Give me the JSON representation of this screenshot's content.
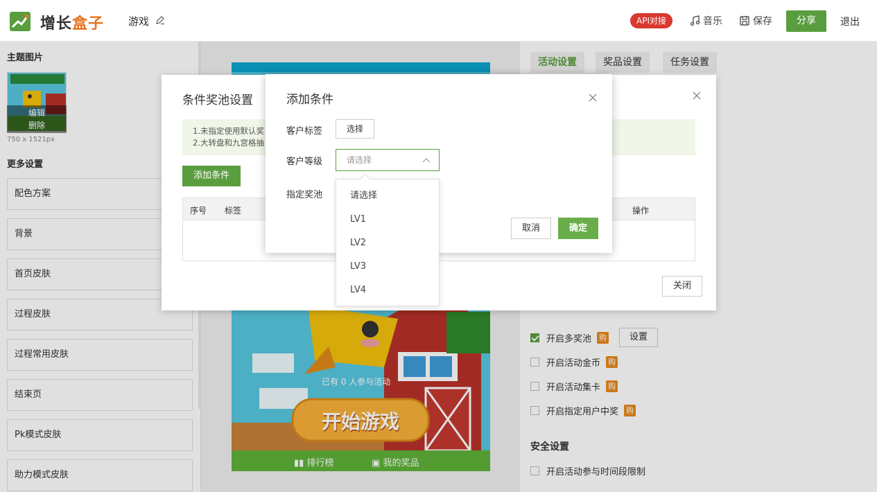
{
  "header": {
    "brand_part1": "增长",
    "brand_part2": "盒子",
    "game_name": "游戏",
    "api_badge": "API对接",
    "music": "音乐",
    "save": "保存",
    "share": "分享",
    "logout": "退出"
  },
  "left": {
    "theme_title": "主题图片",
    "thumb_edit": "编辑",
    "thumb_delete": "删除",
    "dimensions": "750 x 1521px",
    "more_title": "更多设置",
    "menu": [
      "配色方案",
      "背景",
      "首页皮肤",
      "过程皮肤",
      "过程常用皮肤",
      "结束页",
      "Pk模式皮肤",
      "助力模式皮肤"
    ]
  },
  "preview": {
    "participants": "已有 0 人参与活动",
    "start": "开始游戏",
    "ranking": "排行榜",
    "my_prizes": "我的奖品"
  },
  "right": {
    "tabs": [
      "活动设置",
      "奖品设置",
      "任务设置"
    ],
    "options": [
      {
        "label": "开启多奖池",
        "checked": true,
        "buy": "购",
        "button": "设置"
      },
      {
        "label": "开启活动金币",
        "checked": false,
        "buy": "购"
      },
      {
        "label": "开启活动集卡",
        "checked": false,
        "buy": "购"
      },
      {
        "label": "开启指定用户中奖",
        "checked": false,
        "buy": "购"
      }
    ],
    "security_title": "安全设置",
    "security_option": "开启活动参与时间段限制"
  },
  "pool_dialog": {
    "title": "条件奖池设置",
    "notice_line1": "1.未指定使用默认奖",
    "notice_line2": "2.大转盘和九宫格抽",
    "add_condition": "添加条件",
    "col_index": "序号",
    "col_tag": "标签",
    "col_action": "操作",
    "close": "关闭"
  },
  "add_dialog": {
    "title": "添加条件",
    "tag_label": "客户标签",
    "select_button": "选择",
    "level_label": "客户等级",
    "level_placeholder": "请选择",
    "pool_label": "指定奖池",
    "cancel": "取消",
    "confirm": "确定"
  },
  "level_options": [
    "请选择",
    "LV1",
    "LV2",
    "LV3",
    "LV4"
  ],
  "colors": {
    "brand_green": "#5a9d3f",
    "brand_orange": "#e8721c",
    "api_red": "#d9382f",
    "buy_orange": "#e8891c"
  }
}
